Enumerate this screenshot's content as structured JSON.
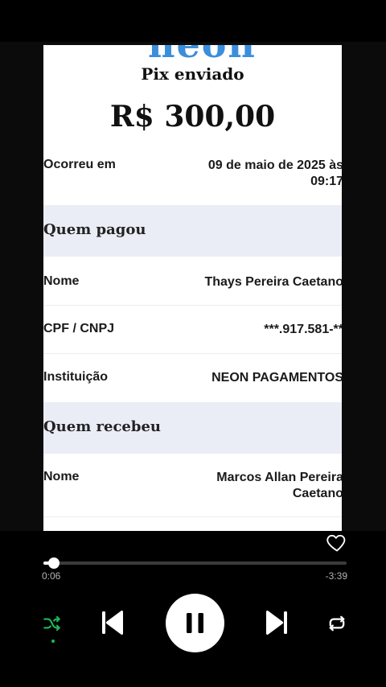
{
  "receipt": {
    "logo_fragment": "neon",
    "title": "Pix enviado",
    "amount": "R$ 300,00",
    "occurred": {
      "label": "Ocorreu em",
      "value_line1": "09 de maio de 2025 às",
      "value_line2": "09:17"
    },
    "payer_section": "Quem pagou",
    "payer": {
      "name_label": "Nome",
      "name_value": "Thays Pereira Caetano",
      "doc_label": "CPF / CNPJ",
      "doc_value": "***.917.581-**",
      "inst_label": "Instituição",
      "inst_value": "NEON PAGAMENTOS"
    },
    "receiver_section": "Quem recebeu",
    "receiver": {
      "name_label": "Nome",
      "name_line1": "Marcos Allan Pereira",
      "name_line2": "Caetano"
    }
  },
  "player": {
    "elapsed": "0:06",
    "remaining": "-3:39",
    "progress": 0.035,
    "colors": {
      "accent": "#1db954",
      "track": "#3c3c3c",
      "thumb": "#ffffff"
    },
    "icons": [
      "heart-icon",
      "shuffle-icon",
      "previous-icon",
      "pause-icon",
      "next-icon",
      "repeat-icon"
    ]
  }
}
